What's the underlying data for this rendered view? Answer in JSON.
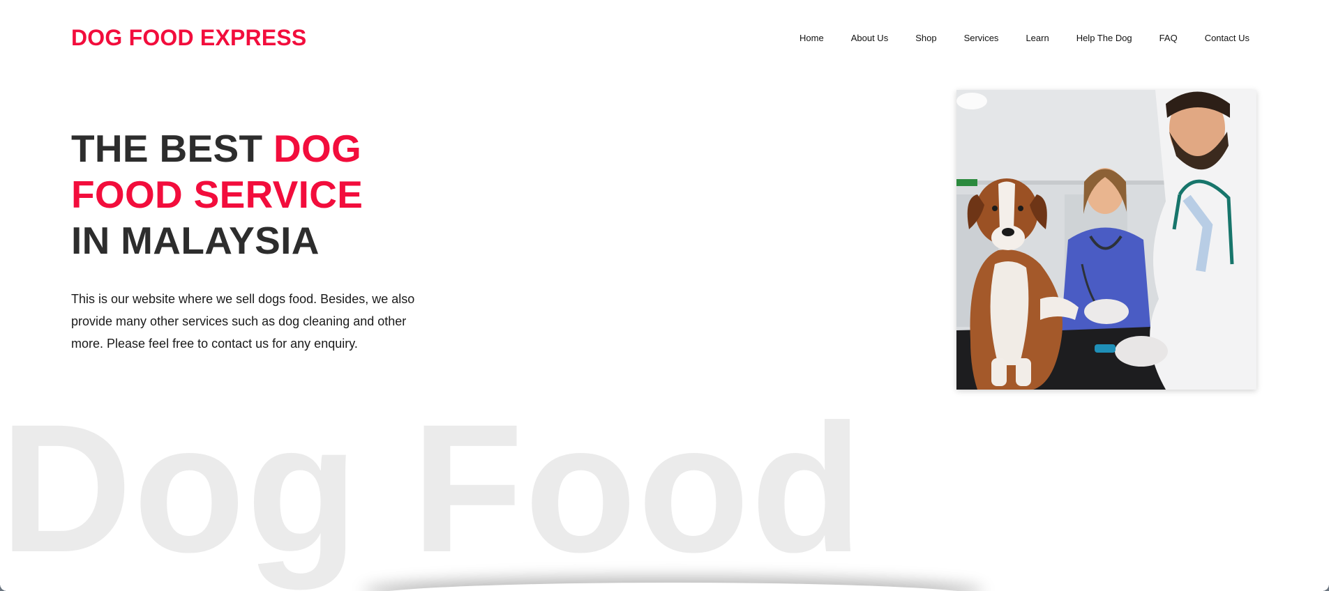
{
  "brand": {
    "name": "DOG FOOD EXPRESS",
    "accent_color": "#f20d3c"
  },
  "nav": {
    "items": [
      "Home",
      "About Us",
      "Shop",
      "Services",
      "Learn",
      "Help The Dog",
      "FAQ",
      "Contact Us"
    ]
  },
  "hero": {
    "title_part1": "THE BEST ",
    "title_red_1": "DOG",
    "title_red_2": "FOOD SERVICE",
    "title_part3": "IN MALAYSIA",
    "description": "This is our website where we sell dogs food. Besides, we also provide many other services such as dog cleaning and other more. Please feel free to contact us for any enquiry.",
    "image_name": "vet-with-dog-photo"
  },
  "watermark": "Dog Food"
}
